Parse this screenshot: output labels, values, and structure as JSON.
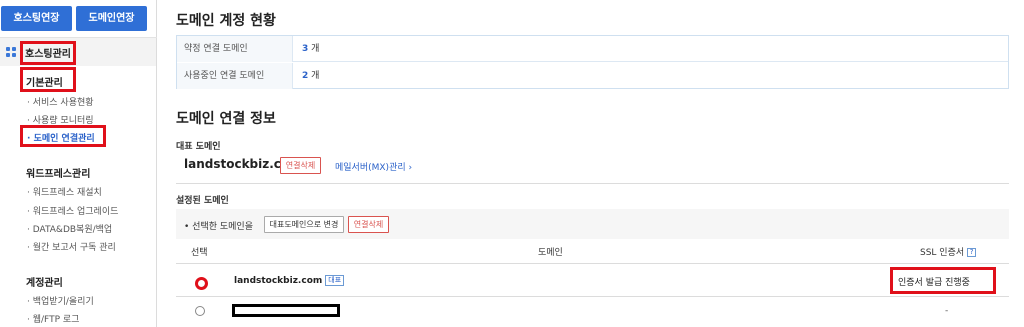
{
  "sidebar": {
    "top_buttons": [
      "호스팅연장",
      "도메인연장"
    ],
    "header_label": "호스팅관리",
    "groups": [
      {
        "title": "기본관리",
        "items": [
          "서비스 사용현황",
          "사용량 모니터링",
          "도메인 연결관리"
        ]
      },
      {
        "title": "워드프레스관리",
        "items": [
          "워드프레스 재설치",
          "워드프레스 업그레이드",
          "DATA&DB복원/백업",
          "월간 보고서 구독 관리"
        ]
      },
      {
        "title": "계정관리",
        "items": [
          "백업받기/올리기",
          "웹/FTP 로그"
        ]
      }
    ]
  },
  "main": {
    "status_title": "도메인 계정 현황",
    "summary": [
      {
        "label": "약정 연결 도메인",
        "value": "3",
        "unit": "개"
      },
      {
        "label": "사용중인 연결 도메인",
        "value": "2",
        "unit": "개"
      }
    ],
    "info_title": "도메인 연결 정보",
    "rep_label": "대표 도메인",
    "rep_domain": "landstockbiz.com",
    "disconnect_label": "연결삭제",
    "mx_link": "메일서버(MX)관리 ›",
    "configured_label": "설정된 도메인",
    "selected_action_text": "• 선택한 도메인을",
    "set_rep_button": "대표도메인으로 변경",
    "disconnect_button": "연결삭제",
    "table_headers": {
      "select": "선택",
      "domain": "도메인",
      "ssl": "SSL 인증서",
      "help": "?"
    },
    "rows": [
      {
        "domain": "landstockbiz.com",
        "badge": "대표",
        "ssl": "인증서 발급 진행중"
      },
      {
        "domain": "",
        "badge": "",
        "ssl": "-"
      }
    ]
  },
  "colors": {
    "accent": "#2f6fd6",
    "highlight": "#e0101a",
    "link": "#2b62c9"
  }
}
